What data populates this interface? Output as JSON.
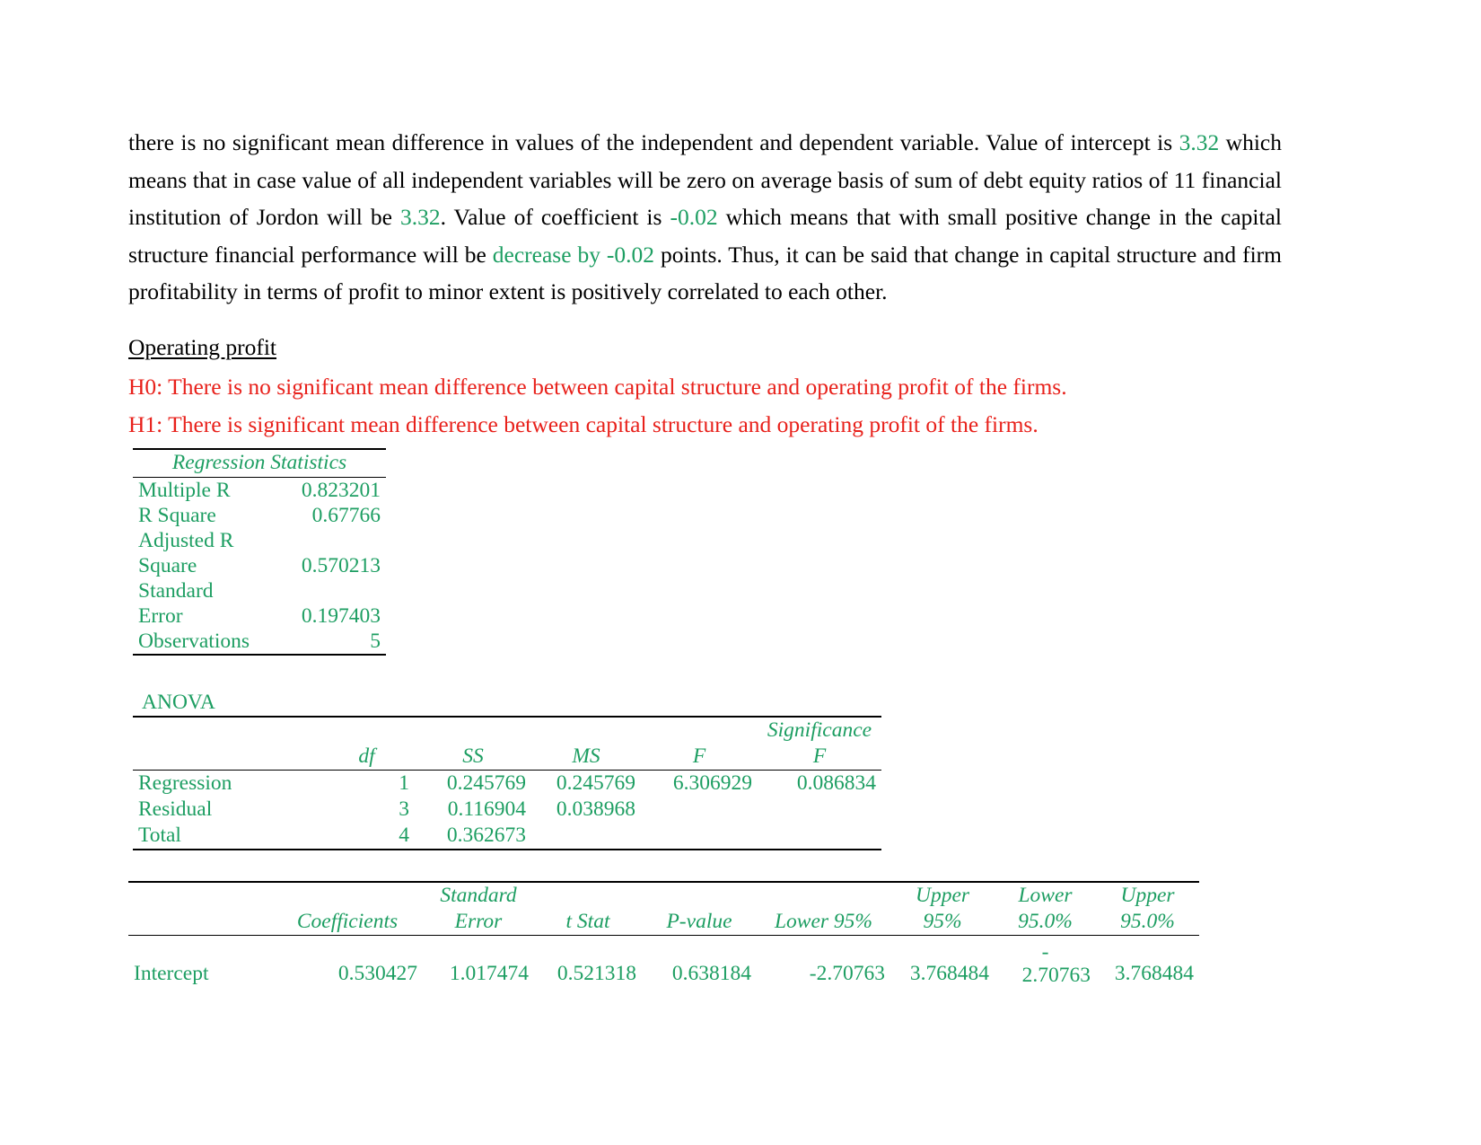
{
  "paragraph": {
    "seg1": "there is no significant mean difference in values of the independent and dependent variable. Value of intercept is ",
    "v1": "3.32",
    "seg2": " which means that in case value of all independent variables will be zero on average basis of sum of debt equity ratios of 11 financial institution of Jordon will be ",
    "v2": "3.32",
    "seg3": ". Value of coefficient is ",
    "v3": "-0.02",
    "seg4": " which means that with small positive change in the capital structure financial performance will be ",
    "v4": "decrease by -0.02",
    "seg5": " points. Thus, it can be said that change in capital structure and firm profitability in terms of profit to minor extent is positively correlated to each other."
  },
  "section": {
    "heading": "Operating profit",
    "h0": "H0: There is no significant mean difference between capital structure and operating profit of the firms.",
    "h1": "H1: There is significant mean difference between capital structure and operating profit of the firms."
  },
  "regression_statistics": {
    "title": "Regression Statistics",
    "rows": [
      {
        "label": "Multiple R",
        "value": "0.823201"
      },
      {
        "label": "R Square",
        "value": "0.67766"
      },
      {
        "label": "Adjusted R Square",
        "value": "0.570213"
      },
      {
        "label": "Standard Error",
        "value": "0.197403"
      },
      {
        "label": "Observations",
        "value": "5"
      }
    ]
  },
  "anova": {
    "title": "ANOVA",
    "headers": [
      "",
      "df",
      "SS",
      "MS",
      "F",
      "Significance F"
    ],
    "rows": [
      {
        "name": "Regression",
        "df": "1",
        "ss": "0.245769",
        "ms": "0.245769",
        "f": "6.306929",
        "sig": "0.086834"
      },
      {
        "name": "Residual",
        "df": "3",
        "ss": "0.116904",
        "ms": "0.038968",
        "f": "",
        "sig": ""
      },
      {
        "name": "Total",
        "df": "4",
        "ss": "0.362673",
        "ms": "",
        "f": "",
        "sig": ""
      }
    ]
  },
  "coefficients": {
    "headers": [
      "",
      "Coefficients",
      "Standard Error",
      "t Stat",
      "P-value",
      "Lower 95%",
      "Upper 95%",
      "Lower 95.0%",
      "Upper 95.0%"
    ],
    "rows": [
      {
        "name": "Intercept",
        "coef": "0.530427",
        "se": "1.017474",
        "t": "0.521318",
        "p": "0.638184",
        "lower95": "-2.70763",
        "upper95": "3.768484",
        "lower950_sign": "-",
        "lower950": "2.70763",
        "upper950": "3.768484"
      }
    ]
  },
  "colors": {
    "green": "#1d9e62",
    "red": "#e8211b",
    "black": "#000000"
  }
}
